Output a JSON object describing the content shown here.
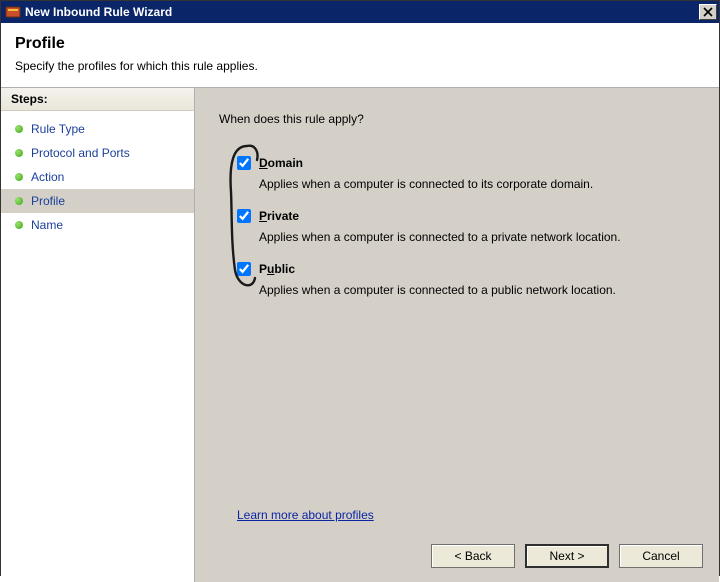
{
  "titlebar": {
    "title": "New Inbound Rule Wizard"
  },
  "header": {
    "title": "Profile",
    "subtitle": "Specify the profiles for which this rule applies."
  },
  "sidebar": {
    "heading": "Steps:",
    "items": [
      {
        "label": "Rule Type"
      },
      {
        "label": "Protocol and Ports"
      },
      {
        "label": "Action"
      },
      {
        "label": "Profile"
      },
      {
        "label": "Name"
      }
    ],
    "current_index": 3
  },
  "main": {
    "question": "When does this rule apply?",
    "options": [
      {
        "name": "Domain",
        "checked": true,
        "desc": "Applies when a computer is connected to its corporate domain."
      },
      {
        "name": "Private",
        "checked": true,
        "desc": "Applies when a computer is connected to a private network location."
      },
      {
        "name": "Public",
        "checked": true,
        "desc": "Applies when a computer is connected to a public network location."
      }
    ],
    "learn_more": "Learn more about profiles"
  },
  "buttons": {
    "back": "< Back",
    "next": "Next >",
    "cancel": "Cancel"
  }
}
